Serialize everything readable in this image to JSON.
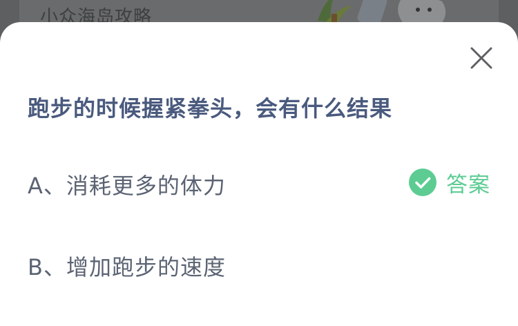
{
  "background": {
    "title": "小众海岛攻略"
  },
  "quiz": {
    "question": "跑步的时候握紧拳头，会有什么结果",
    "options": [
      {
        "label": "A、消耗更多的体力",
        "is_answer": true
      },
      {
        "label": "B、增加跑步的速度",
        "is_answer": false
      }
    ],
    "answer_label": "答案"
  },
  "icons": {
    "close": "close-icon",
    "check": "check-circle-icon"
  },
  "colors": {
    "title": "#4a5a7e",
    "option_text": "#5b6373",
    "answer_green": "#5ccc93",
    "overlay": "#5f6061"
  }
}
